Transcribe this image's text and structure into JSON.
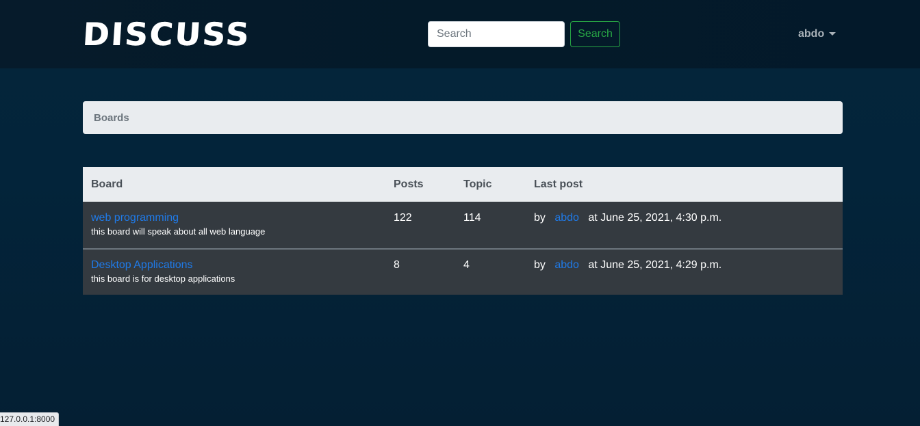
{
  "navbar": {
    "brand": "DISCUSS",
    "search": {
      "placeholder": "Search",
      "value": "",
      "button_label": "Search"
    },
    "user": {
      "name": "abdo"
    }
  },
  "breadcrumb": {
    "label": "Boards"
  },
  "table": {
    "headers": {
      "board": "Board",
      "posts": "Posts",
      "topic": "Topic",
      "last_post": "Last post"
    },
    "rows": [
      {
        "name": "web programming",
        "description": "this board will speak about all web language",
        "posts": "122",
        "topics": "114",
        "by_label": "by",
        "author": "abdo",
        "at_text": "at June 25, 2021, 4:30 p.m."
      },
      {
        "name": "Desktop Applications",
        "description": "this board is for desktop applications",
        "posts": "8",
        "topics": "4",
        "by_label": "by",
        "author": "abdo",
        "at_text": "at June 25, 2021, 4:29 p.m."
      }
    ]
  },
  "status_bar": {
    "url": "127.0.0.1:8000"
  },
  "colors": {
    "page_bg": "#04263a",
    "navbar_bg": "#061b2b",
    "link": "#1f7ae8",
    "success": "#28a745",
    "row_bg": "#343a40",
    "header_bg": "#e9ecef"
  }
}
